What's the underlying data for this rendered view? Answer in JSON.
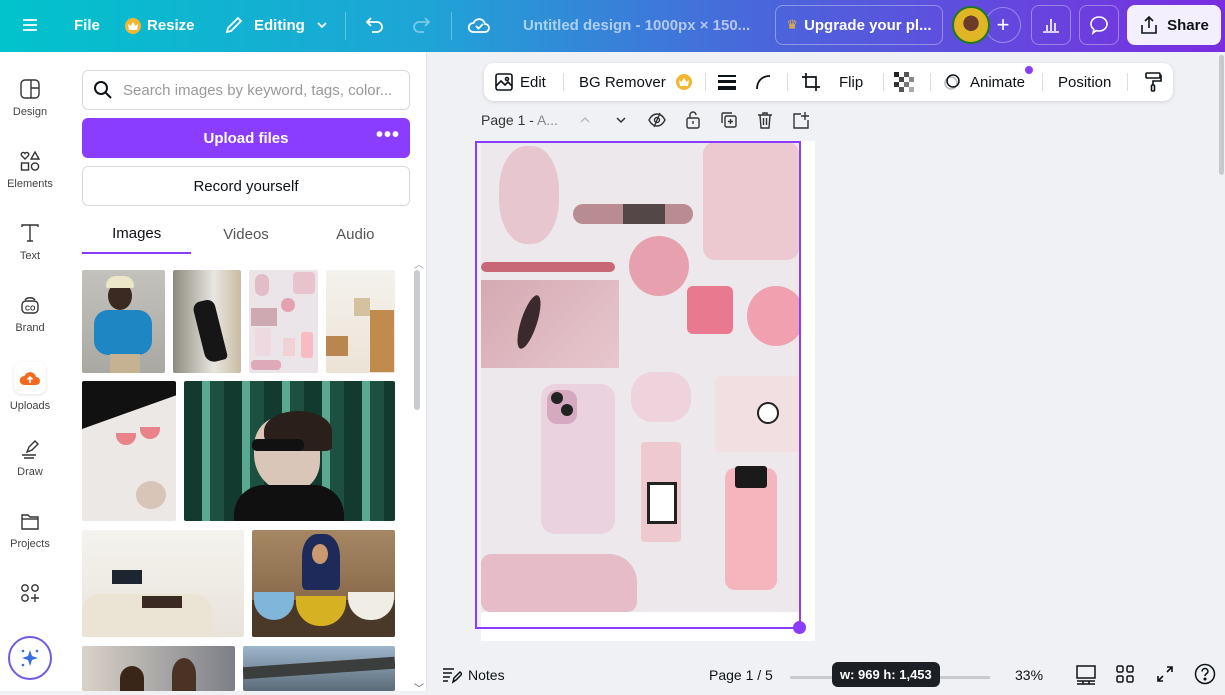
{
  "topbar": {
    "menu_icon": "hamburger-icon",
    "file_label": "File",
    "resize_label": "Resize",
    "editing_label": "Editing",
    "design_title": "Untitled design - 1000px × 150...",
    "upgrade_label": "Upgrade your pl...",
    "share_label": "Share",
    "plus_label": "+"
  },
  "rail": {
    "items": [
      {
        "label": "Design",
        "icon": "layout-icon"
      },
      {
        "label": "Elements",
        "icon": "shapes-icon"
      },
      {
        "label": "Text",
        "icon": "text-icon"
      },
      {
        "label": "Brand",
        "icon": "brand-icon"
      },
      {
        "label": "Uploads",
        "icon": "cloud-upload-icon"
      },
      {
        "label": "Draw",
        "icon": "pen-icon"
      },
      {
        "label": "Projects",
        "icon": "folder-icon"
      }
    ]
  },
  "panel": {
    "search_placeholder": "Search images by keyword, tags, color...",
    "upload_label": "Upload files",
    "upload_more": "•••",
    "record_label": "Record yourself",
    "tabs": [
      {
        "label": "Images",
        "active": true
      },
      {
        "label": "Videos",
        "active": false
      },
      {
        "label": "Audio",
        "active": false
      }
    ],
    "thumbnails": [
      {
        "name": "person-blue-jacket",
        "color": "#2a8bc4"
      },
      {
        "name": "woman-street-wall",
        "color": "#9c9a92"
      },
      {
        "name": "pink-flatlay",
        "color": "#e7cfd6"
      },
      {
        "name": "cafe-interior",
        "color": "#e3d4c2"
      },
      {
        "name": "pink-cocktails",
        "color": "#e9e2df"
      },
      {
        "name": "woman-sunglasses-green",
        "color": "#1f4a3c"
      },
      {
        "name": "living-room",
        "color": "#e6e2da"
      },
      {
        "name": "woman-food-bowls",
        "color": "#8d6d4a"
      },
      {
        "name": "office-meeting",
        "color": "#a89a8a"
      },
      {
        "name": "bridge-city",
        "color": "#6a7c8c"
      }
    ]
  },
  "toolbar": {
    "edit_label": "Edit",
    "bg_remover_label": "BG Remover",
    "flip_label": "Flip",
    "animate_label": "Animate",
    "position_label": "Position"
  },
  "page": {
    "title": "Page 1 - ",
    "title_suffix": "A..."
  },
  "footer": {
    "notes_label": "Notes",
    "page_indicator": "Page 1 / 5",
    "dimensions_tooltip": "w: 969 h: 1,453",
    "zoom_level": "33%"
  },
  "colors": {
    "accent": "#8b3dff",
    "crown": "#f5b731"
  }
}
